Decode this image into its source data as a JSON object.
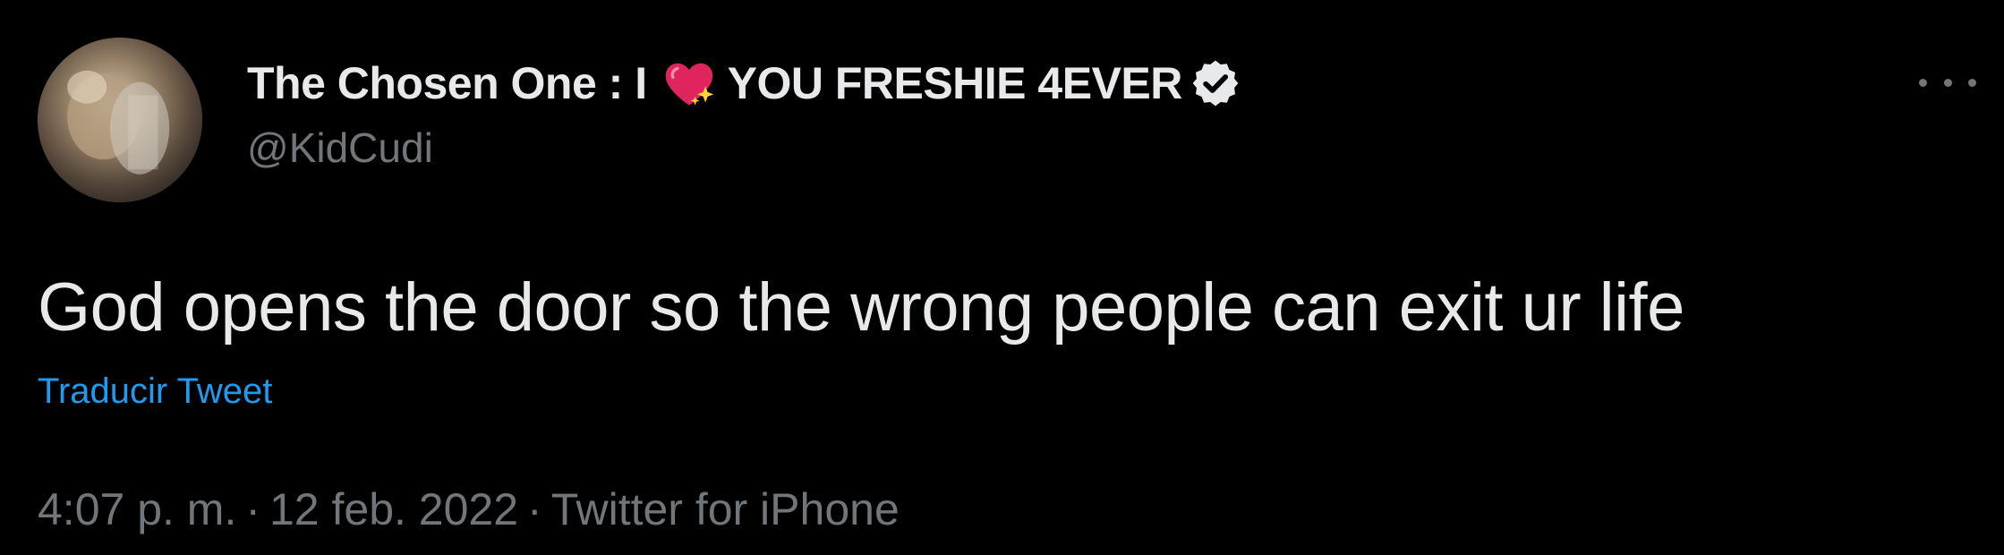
{
  "tweet": {
    "author": {
      "name_prefix": "The Chosen One : I",
      "name_emoji": "sparkling-heart-icon",
      "name_suffix": "YOU FRESHIE 4EVER",
      "verified_icon": "verified-badge-icon",
      "handle": "@KidCudi"
    },
    "more_icon": "more-options-icon",
    "text": "God opens the door so the wrong people can exit ur life",
    "translate_label": "Traducir Tweet",
    "meta": {
      "time": "4:07 p. m.",
      "separator": "·",
      "date": "12 feb. 2022",
      "source": "Twitter for iPhone"
    }
  },
  "colors": {
    "background": "#000000",
    "text_primary": "#e7e9ea",
    "text_secondary": "#71767b",
    "link": "#1d9bf0",
    "heart": "#e0245e",
    "sparkle": "#ffd43b"
  }
}
